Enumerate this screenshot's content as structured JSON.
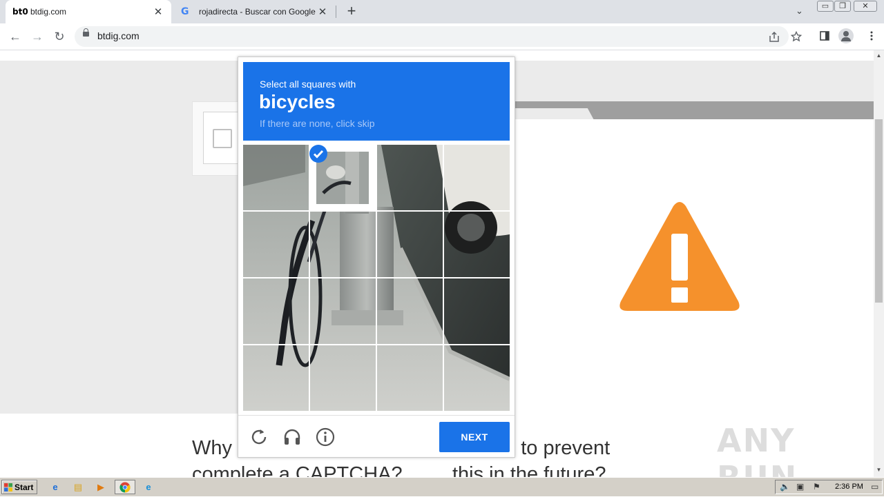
{
  "browser": {
    "tabs": [
      {
        "favicon": "bt0",
        "title": "btdig.com",
        "close": "✕"
      },
      {
        "favicon": "G",
        "title": "rojadirecta - Buscar con Google",
        "close": "✕"
      }
    ],
    "new_tab": "+",
    "tab_search": "⌄",
    "window_controls": {
      "minimize": "▭",
      "restore": "❐",
      "close": "✕"
    },
    "nav": {
      "back": "←",
      "forward": "→",
      "reload": "↻"
    },
    "url": "btdig.com",
    "icons": [
      "share-icon",
      "star-icon",
      "side-panel-icon",
      "profile-icon",
      "menu-icon"
    ]
  },
  "captcha": {
    "instruction": "Select all squares with",
    "target": "bicycles",
    "hint": "If there are none, click skip",
    "selected_tiles": [
      1
    ],
    "next_label": "NEXT",
    "footer_icons": [
      "reload-icon",
      "audio-icon",
      "info-icon"
    ]
  },
  "page": {
    "faq_left": [
      "Why",
      "complete a CAPTCHA?"
    ],
    "faq_right": [
      "can I do to prevent",
      "this in the future?"
    ],
    "accent_color": "#1a73e8",
    "warning_color": "#f5912c"
  },
  "watermark": "ANY RUN",
  "taskbar": {
    "start_label": "Start",
    "clock": "2:36 PM",
    "apps": [
      "ie-icon",
      "explorer-icon",
      "media-player-icon",
      "chrome-icon",
      "edge-icon"
    ]
  }
}
